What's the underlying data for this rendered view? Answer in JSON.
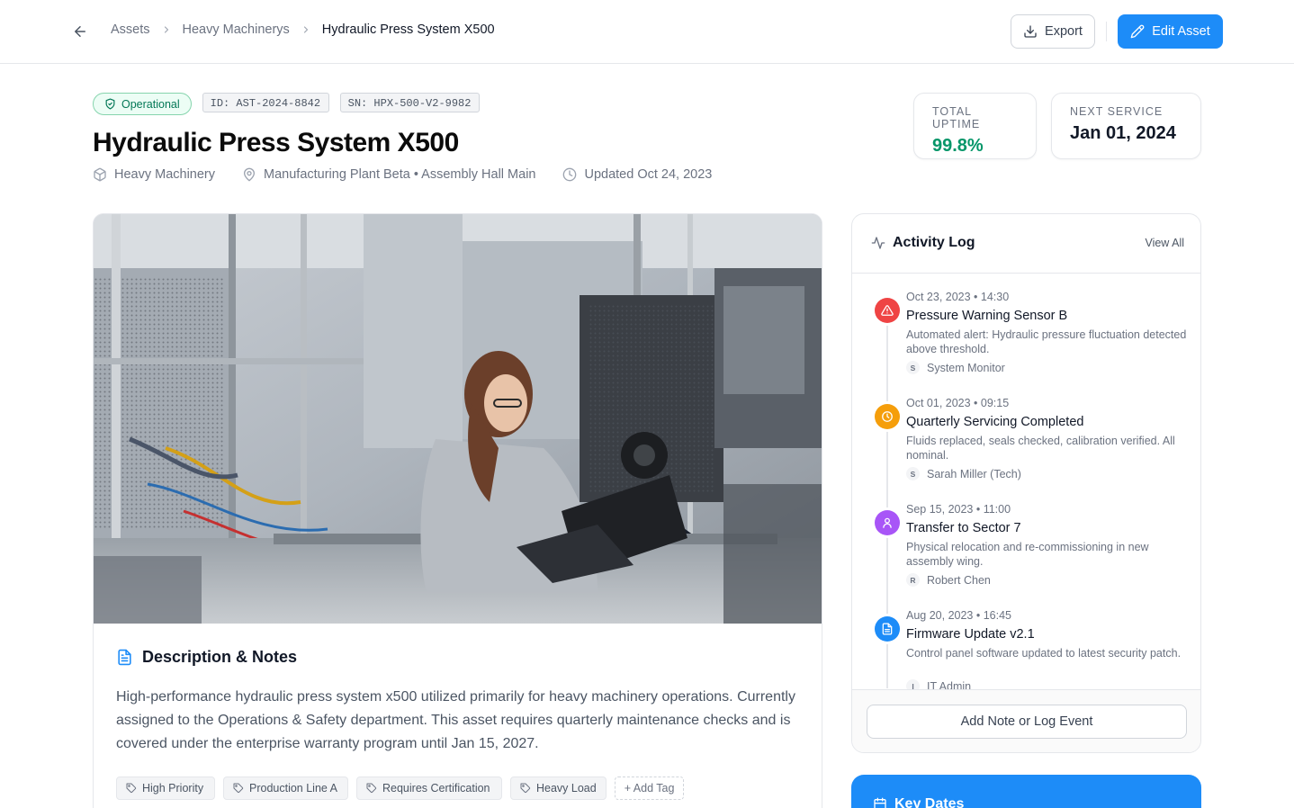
{
  "breadcrumb": {
    "items": [
      "Assets",
      "Heavy Machinerys",
      "Hydraulic Press System X500"
    ]
  },
  "toolbar": {
    "export_label": "Export",
    "edit_label": "Edit Asset"
  },
  "asset": {
    "status": "Operational",
    "id_label": "ID: AST-2024-8842",
    "sn_label": "SN: HPX-500-V2-9982",
    "title": "Hydraulic Press System X500",
    "category": "Heavy Machinery",
    "location": "Manufacturing Plant Beta • Assembly Hall Main",
    "updated": "Updated Oct 24, 2023"
  },
  "stats": {
    "uptime_label": "TOTAL UPTIME",
    "uptime_value": "99.8%",
    "service_label": "NEXT SERVICE",
    "service_value": "Jan 01, 2024"
  },
  "description": {
    "heading": "Description & Notes",
    "text": "High-performance hydraulic press system x500 utilized primarily for heavy machinery operations. Currently assigned to the Operations & Safety department. This asset requires quarterly maintenance checks and is covered under the enterprise warranty program until Jan 15, 2027.",
    "tags": [
      "High Priority",
      "Production Line A",
      "Requires Certification",
      "Heavy Load"
    ],
    "add_tag_label": "+ Add Tag"
  },
  "activity": {
    "title": "Activity Log",
    "view_all": "View All",
    "events": [
      {
        "time": "Oct 23, 2023 • 14:30",
        "title": "Pressure Warning Sensor B",
        "desc": "Automated alert: Hydraulic pressure fluctuation detected above threshold.",
        "user": "System Monitor",
        "initial": "S",
        "icon": "alert-triangle-icon",
        "color": "#ef4444"
      },
      {
        "time": "Oct 01, 2023 • 09:15",
        "title": "Quarterly Servicing Completed",
        "desc": "Fluids replaced, seals checked, calibration verified. All nominal.",
        "user": "Sarah Miller (Tech)",
        "initial": "S",
        "icon": "clock-icon",
        "color": "#f59e0b"
      },
      {
        "time": "Sep 15, 2023 • 11:00",
        "title": "Transfer to Sector 7",
        "desc": "Physical relocation and re-commissioning in new assembly wing.",
        "user": "Robert Chen",
        "initial": "R",
        "icon": "user-icon",
        "color": "#a855f7"
      },
      {
        "time": "Aug 20, 2023 • 16:45",
        "title": "Firmware Update v2.1",
        "desc": "Control panel software updated to latest security patch.",
        "user": "IT Admin",
        "initial": "I",
        "icon": "document-icon",
        "color": "#1d8cf8"
      }
    ],
    "add_note_label": "Add Note or Log Event"
  },
  "key_dates": {
    "title": "Key Dates"
  },
  "colors": {
    "accent": "#1d8cf8",
    "success": "#059669"
  }
}
